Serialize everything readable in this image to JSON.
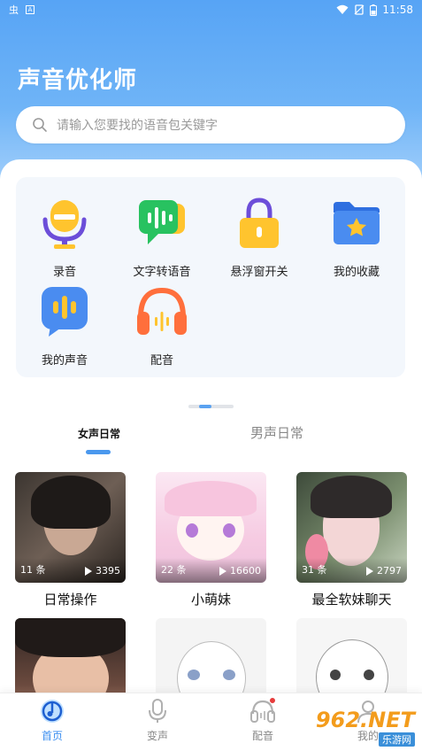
{
  "status_bar": {
    "left_icons": [
      "notification-app-icon",
      "translate-icon"
    ],
    "right_icons": [
      "wifi-icon",
      "no-sim-icon",
      "battery-icon"
    ],
    "time": "11:58"
  },
  "header": {
    "title": "声音优化师",
    "search_placeholder": "请输入您要找的语音包关键字"
  },
  "features": [
    {
      "label": "录音",
      "icon": "microphone-icon"
    },
    {
      "label": "文字转语音",
      "icon": "waveform-chat-icon"
    },
    {
      "label": "悬浮窗开关",
      "icon": "lock-icon"
    },
    {
      "label": "我的收藏",
      "icon": "star-folder-icon"
    },
    {
      "label": "我的声音",
      "icon": "voice-bubble-icon"
    },
    {
      "label": "配音",
      "icon": "headphones-icon"
    }
  ],
  "tabs": [
    {
      "label": "女声日常",
      "active": true
    },
    {
      "label": "男声日常",
      "active": false
    }
  ],
  "cards": [
    {
      "title": "日常操作",
      "count": "11 条",
      "plays": "3395"
    },
    {
      "title": "小萌妹",
      "count": "22 条",
      "plays": "16600"
    },
    {
      "title": "最全软妹聊天",
      "count": "31 条",
      "plays": "2797"
    },
    {
      "title": "",
      "count": "",
      "plays": ""
    },
    {
      "title": "",
      "count": "",
      "plays": ""
    },
    {
      "title": "",
      "count": "",
      "plays": ""
    }
  ],
  "bottom_nav": [
    {
      "label": "首页",
      "icon": "home-music-icon",
      "active": true
    },
    {
      "label": "变声",
      "icon": "microphone-icon",
      "active": false
    },
    {
      "label": "配音",
      "icon": "headphones-icon",
      "active": false,
      "badge": true
    },
    {
      "label": "我的",
      "icon": "profile-icon",
      "active": false
    }
  ],
  "watermark": {
    "main": "962.NET",
    "sub": "乐游网"
  },
  "colors": {
    "accent": "#4a98ee",
    "hero": "#57a4f5",
    "badge": "#e63b3b"
  }
}
